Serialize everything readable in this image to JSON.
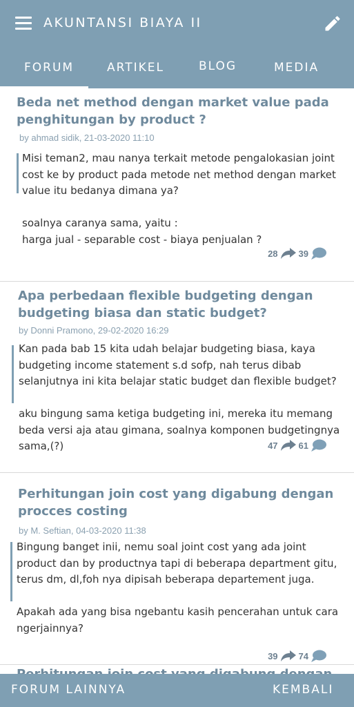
{
  "app": {
    "title": "AKUNTANSI BIAYA II",
    "header_color": "#7f9fb3"
  },
  "tabs": [
    {
      "label": "FORUM",
      "active": true
    },
    {
      "label": "ARTIKEL",
      "active": false
    },
    {
      "label": "BLOG",
      "active": false
    },
    {
      "label": "MEDIA",
      "active": false
    }
  ],
  "posts": [
    {
      "title": "Beda net method dengan market value pada penghitungan by product ?",
      "meta": "by ahmad sidik, 21-03-2020 11:10",
      "body": "Misi teman2, mau nanya terkait metode pengalokasian joint cost ke by product pada metode net method dengan market value itu bedanya dimana ya?\n\nsoalnya caranya sama, yaitu :\nharga jual - separable cost - biaya penjualan ?",
      "shares": "28",
      "comments": "39"
    },
    {
      "title": "Apa perbedaan flexible budgeting dengan budgeting biasa dan static budget?",
      "meta": "by Donni Pramono, 29-02-2020 16:29",
      "body": "Kan pada bab 15 kita udah belajar budgeting biasa, kaya budgeting income statement s.d sofp, nah terus dibab selanjutnya ini kita belajar static budget dan flexible budget?\n\naku bingung sama ketiga budgeting ini, mereka itu memang beda versi aja atau gimana, soalnya komponen budgetingnya sama,(?)",
      "shares": "47",
      "comments": "61"
    },
    {
      "title": "Perhitungan join cost yang digabung dengan procces costing",
      "meta": "by M. Seftian, 04-03-2020 11:38",
      "body": "Bingung banget inii, nemu soal joint cost yang ada joint product dan by productnya tapi di beberapa department gitu, terus dm, dl,foh nya dipisah beberapa departement juga.\n\nApakah ada yang bisa ngebantu kasih pencerahan untuk cara ngerjainnya?",
      "shares": "39",
      "comments": "74"
    },
    {
      "title": "Perhitungan join cost yang digabung dengan procces"
    }
  ],
  "bottom": {
    "more_label": "FORUM LAINNYA",
    "back_label": "KEMBALI"
  }
}
